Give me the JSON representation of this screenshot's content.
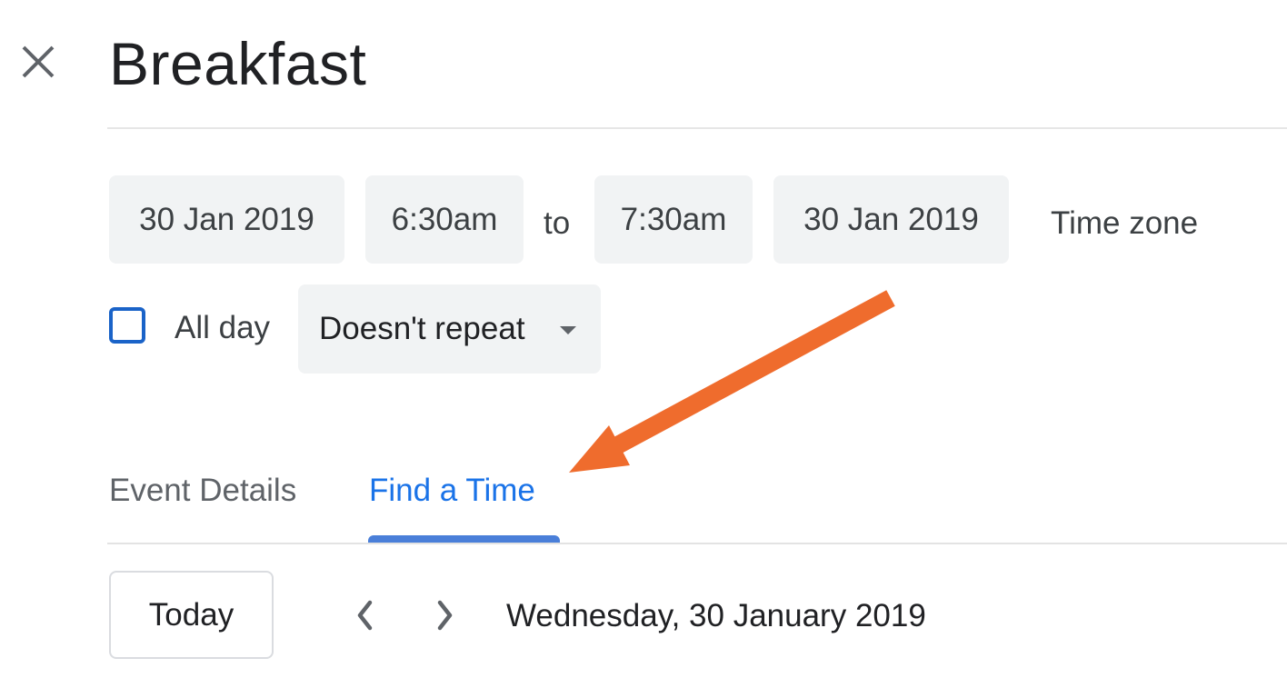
{
  "header": {
    "close_icon": "close-icon",
    "title": "Breakfast"
  },
  "datetime": {
    "start_date": "30 Jan 2019",
    "start_time": "6:30am",
    "separator": "to",
    "end_time": "7:30am",
    "end_date": "30 Jan 2019",
    "time_zone_label": "Time zone"
  },
  "options": {
    "all_day_label": "All day",
    "all_day_checked": false,
    "repeat_value": "Doesn't repeat",
    "repeat_icon": "caret-down-icon"
  },
  "tabs": [
    {
      "label": "Event Details",
      "active": false
    },
    {
      "label": "Find a Time",
      "active": true
    }
  ],
  "navigation": {
    "today_label": "Today",
    "prev_icon": "chevron-left-icon",
    "next_icon": "chevron-right-icon",
    "current_date": "Wednesday, 30 January 2019"
  },
  "annotation": {
    "type": "arrow",
    "points_to": "Find a Time",
    "color": "#ef6c2d"
  },
  "colors": {
    "accent": "#1a73e8",
    "chip_bg": "#f1f3f4",
    "checkbox_border": "#1a63c8",
    "tab_indicator": "#4a7fd9"
  }
}
